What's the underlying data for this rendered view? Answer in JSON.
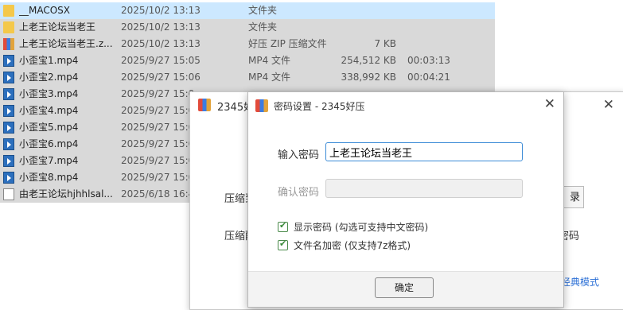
{
  "files": [
    {
      "name": "__MACOSX",
      "date": "2025/10/2 13:13",
      "type": "文件夹",
      "size": "",
      "duration": "",
      "icon": "folder-icon",
      "state": "selected"
    },
    {
      "name": "上老王论坛当老王",
      "date": "2025/10/2 13:13",
      "type": "文件夹",
      "size": "",
      "duration": "",
      "icon": "folder-icon",
      "state": "gray"
    },
    {
      "name": "上老王论坛当老王.z...",
      "date": "2025/10/2 13:13",
      "type": "好压 ZIP 压缩文件",
      "size": "7 KB",
      "duration": "",
      "icon": "zip-icon",
      "state": "gray"
    },
    {
      "name": "小歪宝1.mp4",
      "date": "2025/9/27 15:05",
      "type": "MP4 文件",
      "size": "254,512 KB",
      "duration": "00:03:13",
      "icon": "mp4-icon",
      "state": "gray"
    },
    {
      "name": "小歪宝2.mp4",
      "date": "2025/9/27 15:06",
      "type": "MP4 文件",
      "size": "338,992 KB",
      "duration": "00:04:21",
      "icon": "mp4-icon",
      "state": "gray"
    },
    {
      "name": "小歪宝3.mp4",
      "date": "2025/9/27 15:0",
      "type": "",
      "size": "",
      "duration": "",
      "icon": "mp4-icon",
      "state": "gray"
    },
    {
      "name": "小歪宝4.mp4",
      "date": "2025/9/27 15:0",
      "type": "",
      "size": "",
      "duration": "",
      "icon": "mp4-icon",
      "state": "gray"
    },
    {
      "name": "小歪宝5.mp4",
      "date": "2025/9/27 15:0",
      "type": "",
      "size": "",
      "duration": "",
      "icon": "mp4-icon",
      "state": "gray"
    },
    {
      "name": "小歪宝6.mp4",
      "date": "2025/9/27 15:0",
      "type": "",
      "size": "",
      "duration": "",
      "icon": "mp4-icon",
      "state": "gray"
    },
    {
      "name": "小歪宝7.mp4",
      "date": "2025/9/27 15:0",
      "type": "",
      "size": "",
      "duration": "",
      "icon": "mp4-icon",
      "state": "gray"
    },
    {
      "name": "小歪宝8.mp4",
      "date": "2025/9/27 15:0",
      "type": "",
      "size": "",
      "duration": "",
      "icon": "mp4-icon",
      "state": "gray"
    },
    {
      "name": "由老王论坛hjhhlsal...",
      "date": "2025/6/18 16:4",
      "type": "",
      "size": "",
      "duration": "",
      "icon": "txt-icon",
      "state": "gray"
    }
  ],
  "bg_window": {
    "title": "2345好",
    "label1": "压缩到",
    "label2": "压缩配",
    "button_partial": "录",
    "partial_text": "密码",
    "classic_link": "经典模式"
  },
  "dialog": {
    "title": "密码设置 - 2345好压",
    "input_label": "输入密码",
    "input_value": "上老王论坛当老王",
    "confirm_label": "确认密码",
    "show_password_label": "显示密码 (勾选可支持中文密码)",
    "encrypt_names_label": "文件名加密 (仅支持7z格式)",
    "ok_label": "确定"
  }
}
